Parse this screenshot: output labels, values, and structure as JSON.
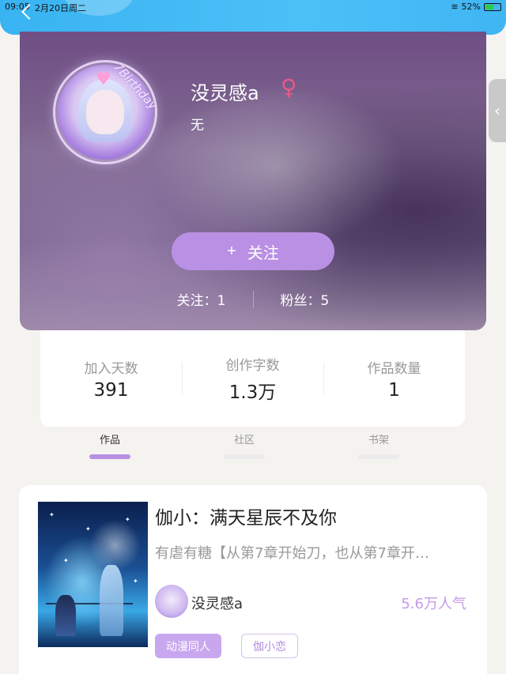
{
  "status_bar": {
    "time": "09:05",
    "date": "2月20日周二",
    "battery": "52%",
    "battery_level": 0.52
  },
  "profile": {
    "name": "没灵感a",
    "gender_symbol": "♀",
    "bio": "无",
    "avatar_badge": "7Birthday",
    "follow_button": {
      "icon": "+",
      "label": "关注"
    },
    "following": "关注：1",
    "followers": "粉丝：5"
  },
  "stats": [
    {
      "label": "加入天数",
      "value": "391"
    },
    {
      "label": "创作字数",
      "value": "1.3万"
    },
    {
      "label": "作品数量",
      "value": "1"
    }
  ],
  "tabs": [
    {
      "label": "作品",
      "active": true
    },
    {
      "label": "社区",
      "active": false
    },
    {
      "label": "书架",
      "active": false
    }
  ],
  "book": {
    "title": "伽小：满天星辰不及你",
    "description": "有虐有糖【从第7章开始刀，也从第7章开…",
    "author": "没灵感a",
    "popularity": "5.6万人气",
    "tags": [
      "动漫同人",
      "伽小恋"
    ]
  },
  "colors": {
    "header": "#39b3f2",
    "accent": "#b990e3",
    "gender": "#e45b86"
  }
}
